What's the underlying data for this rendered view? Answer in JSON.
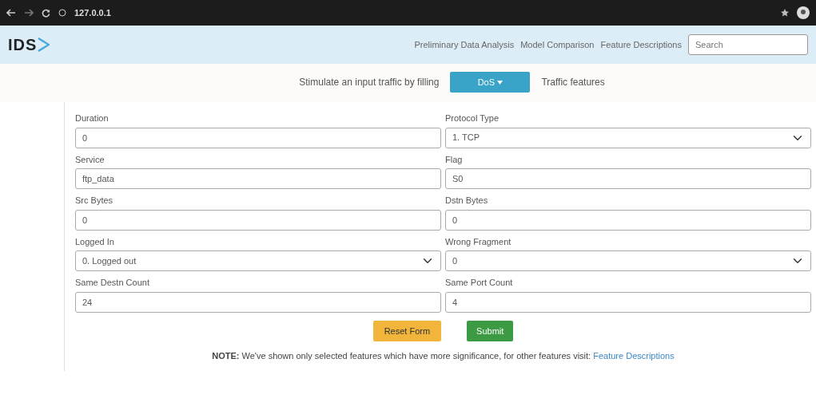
{
  "browser": {
    "address": "127.0.0.1"
  },
  "navbar": {
    "brand": "IDS",
    "links": [
      "Preliminary Data Analysis",
      "Model Comparison",
      "Feature Descriptions"
    ],
    "search": {
      "placeholder": "Search"
    }
  },
  "prompt": {
    "before": "Stimulate an input traffic by filling",
    "dropdown": "DoS",
    "after": "Traffic features"
  },
  "fields": [
    {
      "label": "Duration",
      "kind": "input",
      "value": "0"
    },
    {
      "label": "Protocol Type",
      "kind": "select",
      "value": "1. TCP"
    },
    {
      "label": "Service",
      "kind": "input",
      "value": "ftp_data"
    },
    {
      "label": "Flag",
      "kind": "input",
      "value": "S0"
    },
    {
      "label": "Src Bytes",
      "kind": "input",
      "value": "0"
    },
    {
      "label": "Dstn Bytes",
      "kind": "input",
      "value": "0"
    },
    {
      "label": "Logged In",
      "kind": "select",
      "value": "0. Logged out"
    },
    {
      "label": "Wrong Fragment",
      "kind": "select",
      "value": "0"
    },
    {
      "label": "Same Destn Count",
      "kind": "input",
      "value": "24"
    },
    {
      "label": "Same Port Count",
      "kind": "input",
      "value": "4"
    }
  ],
  "buttons": [
    {
      "label": "Reset Form",
      "kind": "reset"
    },
    {
      "label": "Submit",
      "kind": "submit"
    }
  ],
  "note": {
    "text": "**NOTE:** We've shown only selected features which have more significance, for other features visit:",
    "link": "Feature Descriptions"
  }
}
